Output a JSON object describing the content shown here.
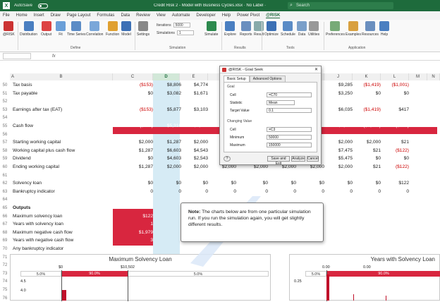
{
  "titlebar": {
    "autosave": "AutoSave",
    "title": "Credit Risk 2 - Model with Business Cycles.xlsx  ·  No Label ·",
    "label": "",
    "search": "Search"
  },
  "menu": [
    "File",
    "Home",
    "Insert",
    "Draw",
    "Page Layout",
    "Formulas",
    "Data",
    "Review",
    "View",
    "Automate",
    "Developer",
    "Help",
    "Power Pivot",
    "@RISK"
  ],
  "ribbon": {
    "buttons": [
      "@RISK",
      "Distribution",
      "Output",
      "Fit",
      "Time Series",
      "Correlation",
      "Function",
      "Model",
      "Settings",
      "Simulate",
      "Explore",
      "Reports",
      "Result",
      "Optimize",
      "Schedule",
      "Data",
      "Utilities",
      "Preferences",
      "Examples",
      "Resources",
      "Help"
    ],
    "groups": [
      "Define",
      "Simulation",
      "Results",
      "Tools",
      "Application"
    ],
    "iterations_label": "Iterations",
    "iterations_value": "5000",
    "simulations_label": "Simulations",
    "simulations_value": "1"
  },
  "formula_bar": {
    "fx": "fx"
  },
  "columns": [
    "A",
    "B",
    "C",
    "D",
    "E",
    "F",
    "G",
    "H",
    "I",
    "J",
    "K",
    "L",
    "M",
    "N"
  ],
  "rows": [
    {
      "n": "50",
      "label": "Tax basis",
      "vals": [
        "($153)",
        "$8,806",
        "$4,774",
        "",
        "",
        "",
        "",
        "$9,285",
        "($1,419)",
        "($1,001)"
      ]
    },
    {
      "n": "51",
      "label": "Tax payable",
      "vals": [
        "$0",
        "$3,082",
        "$1,671",
        "",
        "",
        "",
        "",
        "$3,250",
        "$0",
        "$0"
      ]
    },
    {
      "n": "52",
      "label": "",
      "vals": []
    },
    {
      "n": "53",
      "label": "Earnings after tax (EAT)",
      "vals": [
        "($153)",
        "$5,877",
        "$3,103",
        "",
        "",
        "",
        "",
        "$6,035",
        "($1,419)",
        "$417"
      ]
    },
    {
      "n": "54",
      "label": "",
      "vals": []
    },
    {
      "n": "55",
      "label": "Cash flow",
      "vals": [
        "($713)",
        "$5,316",
        "$2,543",
        "",
        "",
        "",
        "",
        "$5,475",
        "($1,979)",
        "($143)"
      ]
    },
    {
      "n": "56",
      "label": "",
      "vals": []
    },
    {
      "n": "57",
      "label": "Starting working capital",
      "vals": [
        "$2,000",
        "$1,287",
        "$2,000",
        "",
        "",
        "",
        "",
        "$2,000",
        "$2,000",
        "$21"
      ]
    },
    {
      "n": "58",
      "label": "Working capital plus cash flow",
      "vals": [
        "$1,287",
        "$6,603",
        "$4,543",
        "",
        "",
        "",
        "",
        "$7,475",
        "$21",
        "($122)"
      ]
    },
    {
      "n": "59",
      "label": "Dividend",
      "vals": [
        "$0",
        "$4,603",
        "$2,543",
        "",
        "",
        "",
        "",
        "$5,475",
        "$0",
        "$0"
      ]
    },
    {
      "n": "60",
      "label": "Ending working capital",
      "vals": [
        "$1,287",
        "$2,000",
        "$2,000",
        "$2,000",
        "$2,000",
        "$2,000",
        "$2,000",
        "$2,000",
        "$21",
        "($122)"
      ]
    },
    {
      "n": "61",
      "label": "",
      "vals": []
    },
    {
      "n": "62",
      "label": "Solvency loan",
      "vals": [
        "$0",
        "$0",
        "$0",
        "$0",
        "$0",
        "$0",
        "$0",
        "$0",
        "$0",
        "$122"
      ]
    },
    {
      "n": "63",
      "label": "Bankruptcy indicator",
      "vals": [
        "0",
        "0",
        "0",
        "0",
        "0",
        "0",
        "0",
        "0",
        "0",
        "0"
      ]
    },
    {
      "n": "64",
      "label": "",
      "vals": []
    },
    {
      "n": "65",
      "label": "Outputs",
      "vals": []
    },
    {
      "n": "66",
      "label": "Maximum solvency loan",
      "vals": [
        "$122"
      ]
    },
    {
      "n": "67",
      "label": "Years with solvency loan",
      "vals": [
        "1"
      ]
    },
    {
      "n": "68",
      "label": "Maximum negative cash flow",
      "vals": [
        "$1,979"
      ]
    },
    {
      "n": "69",
      "label": "Years with negative cash flow",
      "vals": [
        "3"
      ]
    },
    {
      "n": "70",
      "label": "Any bankruptcy indicator",
      "vals": [
        "0"
      ]
    },
    {
      "n": "71",
      "label": "",
      "vals": []
    },
    {
      "n": "72",
      "label": "",
      "vals": []
    },
    {
      "n": "73",
      "label": "",
      "vals": []
    },
    {
      "n": "74",
      "label": "",
      "vals": []
    },
    {
      "n": "75",
      "label": "",
      "vals": []
    },
    {
      "n": "76",
      "label": "",
      "vals": []
    }
  ],
  "goal_seek": {
    "title": "@RISK - Goal Seek",
    "tab1": "Basic Setup",
    "tab2": "Advanced Options",
    "goal_section": "Goal",
    "cell_label": "Cell",
    "cell_value": "=C70",
    "statistic_label": "Statistic",
    "statistic_value": "Mean",
    "target_label": "Target Value",
    "target_value": "0.1",
    "changing_section": "Changing Value",
    "cv_cell_label": "Cell",
    "cv_cell_value": "=C3",
    "min_label": "Minimum",
    "min_value": "50000",
    "max_label": "Maximum",
    "max_value": "150000",
    "btn_save": "Save and Exit",
    "btn_analyze": "Analyze",
    "btn_cancel": "Cancel"
  },
  "note": {
    "bold": "Note:",
    "text": " The charts below are from one particular simulation run. If you run the simulation again, you will get slightly different results."
  },
  "charts": {
    "left": {
      "title": "Maximum Solvency Loan",
      "x_start": "$0",
      "x_mark": "$10,502",
      "bands": [
        "5.0%",
        "90.0%",
        "5.0%"
      ],
      "y_ticks": [
        "4.5",
        "4.0"
      ]
    },
    "right": {
      "title": "Years with Solvency Loan",
      "x_start": "0.00",
      "x_mark": "0.00",
      "bands": [
        "5.0%",
        "90.0%"
      ],
      "y_ticks": [
        "0.25"
      ]
    }
  },
  "colors": {
    "excel_green": "#1e6b3c",
    "red_band": "#d8263f",
    "selected_col": "#cfe8f3"
  }
}
